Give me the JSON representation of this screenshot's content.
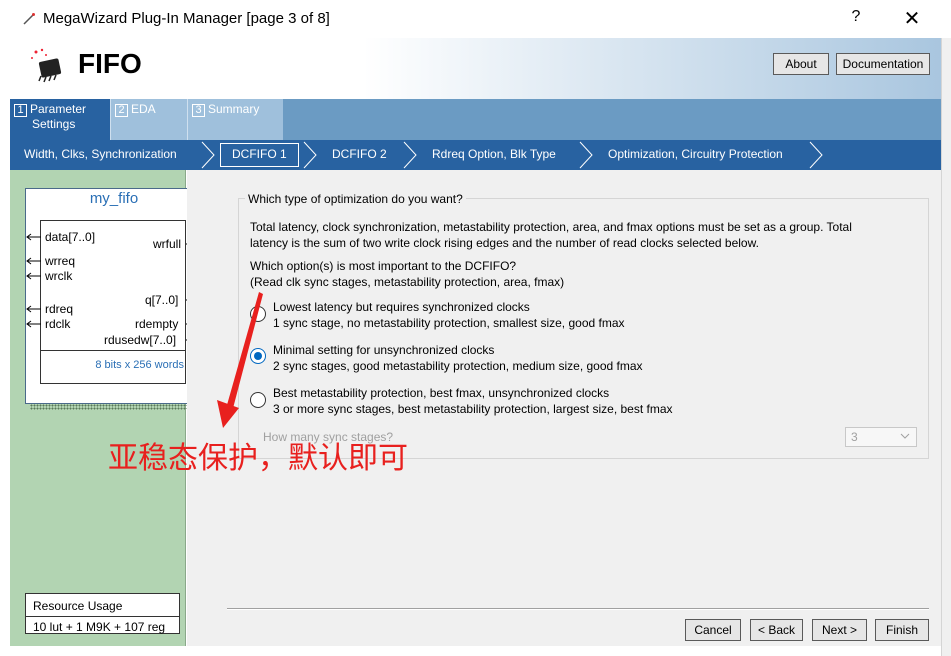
{
  "window": {
    "title": "MegaWizard Plug-In Manager [page 3 of 8]",
    "help": "?",
    "close": "✕"
  },
  "header": {
    "title": "FIFO",
    "about_label": "About",
    "documentation_label": "Documentation"
  },
  "tabs": [
    {
      "num": "1",
      "label": "Parameter",
      "label2": "Settings"
    },
    {
      "num": "2",
      "label": "EDA"
    },
    {
      "num": "3",
      "label": "Summary"
    }
  ],
  "breadcrumb": [
    "Width, Clks, Synchronization",
    "DCFIFO 1",
    "DCFIFO 2",
    "Rdreq Option, Blk Type",
    "Optimization, Circuitry Protection"
  ],
  "symbol": {
    "name": "my_fifo",
    "inputs": [
      "data[7..0]",
      "wrreq",
      "wrclk",
      "rdreq",
      "rdclk"
    ],
    "outputs": [
      "wrfull",
      "q[7..0]",
      "rdempty",
      "rdusedw[7..0]"
    ],
    "note": "8 bits x 256 words"
  },
  "resource": {
    "label": "Resource Usage",
    "value": "10 lut + 1 M9K + 107 reg"
  },
  "main": {
    "group_title": "Which type of optimization do you want?",
    "description_line1": "Total latency, clock synchronization, metastability protection, area, and fmax options must be set as a group.  Total",
    "description_line2": "latency is the sum of two write clock rising edges and the number of read clocks selected below.",
    "question_line1": "Which option(s) is most important to the DCFIFO?",
    "question_line2": "(Read clk sync stages, metastability protection, area, fmax)",
    "options": [
      {
        "line1": "Lowest latency but requires synchronized clocks",
        "line2": "1 sync stage, no metastability protection, smallest size, good fmax",
        "checked": false
      },
      {
        "line1": "Minimal setting for unsynchronized clocks",
        "line2": "2 sync stages, good metastability protection, medium size, good fmax",
        "checked": true
      },
      {
        "line1": "Best metastability protection, best fmax, unsynchronized clocks",
        "line2": "3 or more sync stages, best metastability protection, largest size, best fmax",
        "checked": false
      }
    ],
    "sync_stages_label": "How many sync stages?",
    "sync_stages_value": "3"
  },
  "annotation": "亚稳态保护，默认即可",
  "footer": {
    "cancel": "Cancel",
    "back": "< Back",
    "next": "Next >",
    "finish": "Finish"
  },
  "colors": {
    "accent_blue": "#2862a1",
    "left_panel_green": "#b2d4b2",
    "annotation_red": "#e8201e",
    "radio_checked": "#0067c0"
  }
}
